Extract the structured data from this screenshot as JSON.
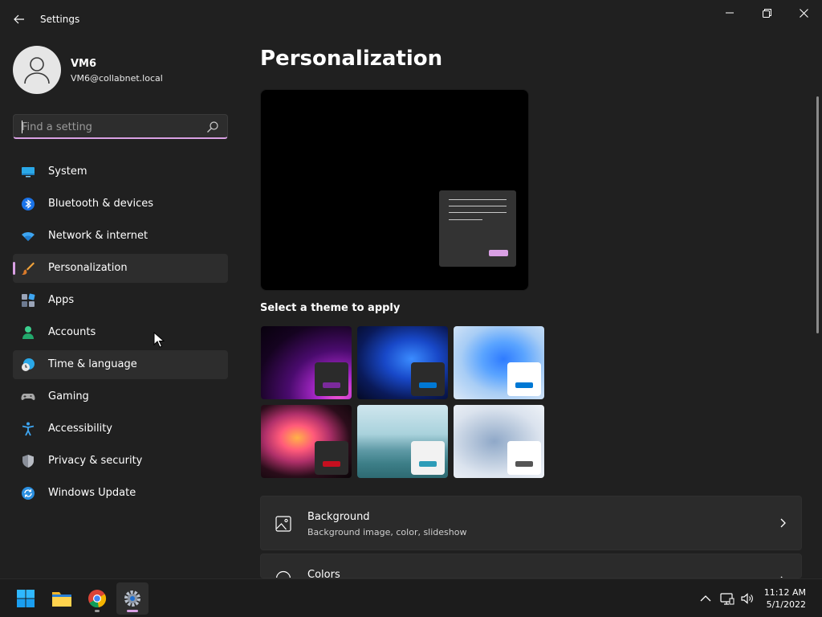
{
  "window": {
    "title": "Settings"
  },
  "profile": {
    "name": "VM6",
    "email": "VM6@collabnet.local"
  },
  "search": {
    "placeholder": "Find a setting",
    "value": ""
  },
  "nav": {
    "items": [
      {
        "label": "System",
        "icon": "monitor-icon"
      },
      {
        "label": "Bluetooth & devices",
        "icon": "bluetooth-icon"
      },
      {
        "label": "Network & internet",
        "icon": "wifi-icon"
      },
      {
        "label": "Personalization",
        "icon": "paintbrush-icon",
        "selected": true
      },
      {
        "label": "Apps",
        "icon": "apps-icon"
      },
      {
        "label": "Accounts",
        "icon": "person-icon"
      },
      {
        "label": "Time & language",
        "icon": "globe-clock-icon",
        "hovered": true
      },
      {
        "label": "Gaming",
        "icon": "gamepad-icon"
      },
      {
        "label": "Accessibility",
        "icon": "accessibility-icon"
      },
      {
        "label": "Privacy & security",
        "icon": "shield-icon"
      },
      {
        "label": "Windows Update",
        "icon": "update-icon"
      }
    ]
  },
  "main": {
    "title": "Personalization",
    "theme_heading": "Select a theme to apply",
    "themes": [
      {
        "id": "glow-dark",
        "accent": "#7b2a9c"
      },
      {
        "id": "bloom-dark",
        "accent": "#0078d4"
      },
      {
        "id": "bloom-light",
        "accent": "#0078d4"
      },
      {
        "id": "captured-motion",
        "accent": "#c50f1f"
      },
      {
        "id": "sunrise-lake",
        "accent": "#2d9cb8"
      },
      {
        "id": "flow",
        "accent": "#555555"
      }
    ],
    "cards": [
      {
        "title": "Background",
        "subtitle": "Background image, color, slideshow",
        "icon": "image-icon"
      },
      {
        "title": "Colors",
        "subtitle": "",
        "icon": "palette-icon"
      }
    ]
  },
  "taskbar": {
    "apps": [
      {
        "name": "Start",
        "icon": "windows-start-icon"
      },
      {
        "name": "File Explorer",
        "icon": "folder-icon"
      },
      {
        "name": "Google Chrome",
        "icon": "chrome-icon"
      },
      {
        "name": "Settings",
        "icon": "gear-icon",
        "active": true
      }
    ],
    "time": "11:12 AM",
    "date": "5/1/2022"
  },
  "colors": {
    "accent": "#d9a0e4",
    "background": "#202020",
    "card": "#2b2b2b"
  }
}
